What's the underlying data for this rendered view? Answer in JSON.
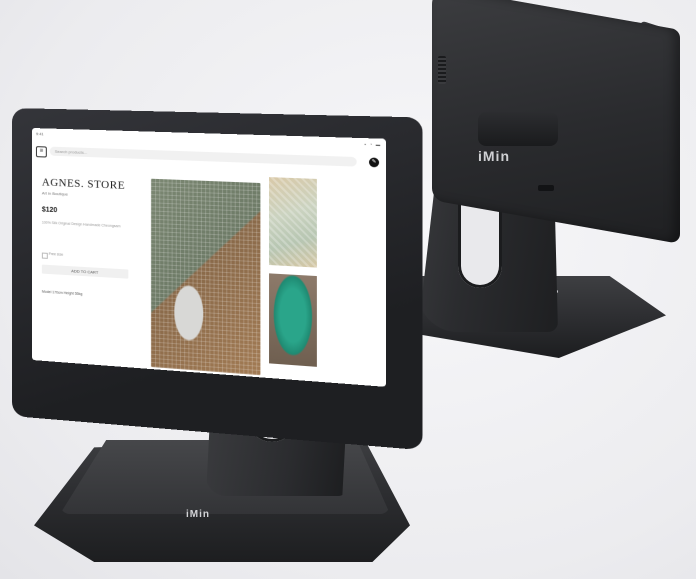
{
  "device": {
    "brand_logo_rear": "iMin",
    "brand_logo_base": "iMin"
  },
  "screen": {
    "status_time": "9:41",
    "status_icons": "▪ ◔ ▬",
    "search_placeholder": "Search products...",
    "store_name": "AGNES. STORE",
    "store_subtitle": "Art in Boutique",
    "price": "$120",
    "description": "100% Silk Original Design Handmade Cheongsam",
    "size_label": "Free size",
    "add_button": "ADD TO CART",
    "extra_info": "Model 170cm Height 55kg"
  },
  "colors": {
    "device_body": "#2b2c2f",
    "screen_bg": "#ffffff"
  }
}
